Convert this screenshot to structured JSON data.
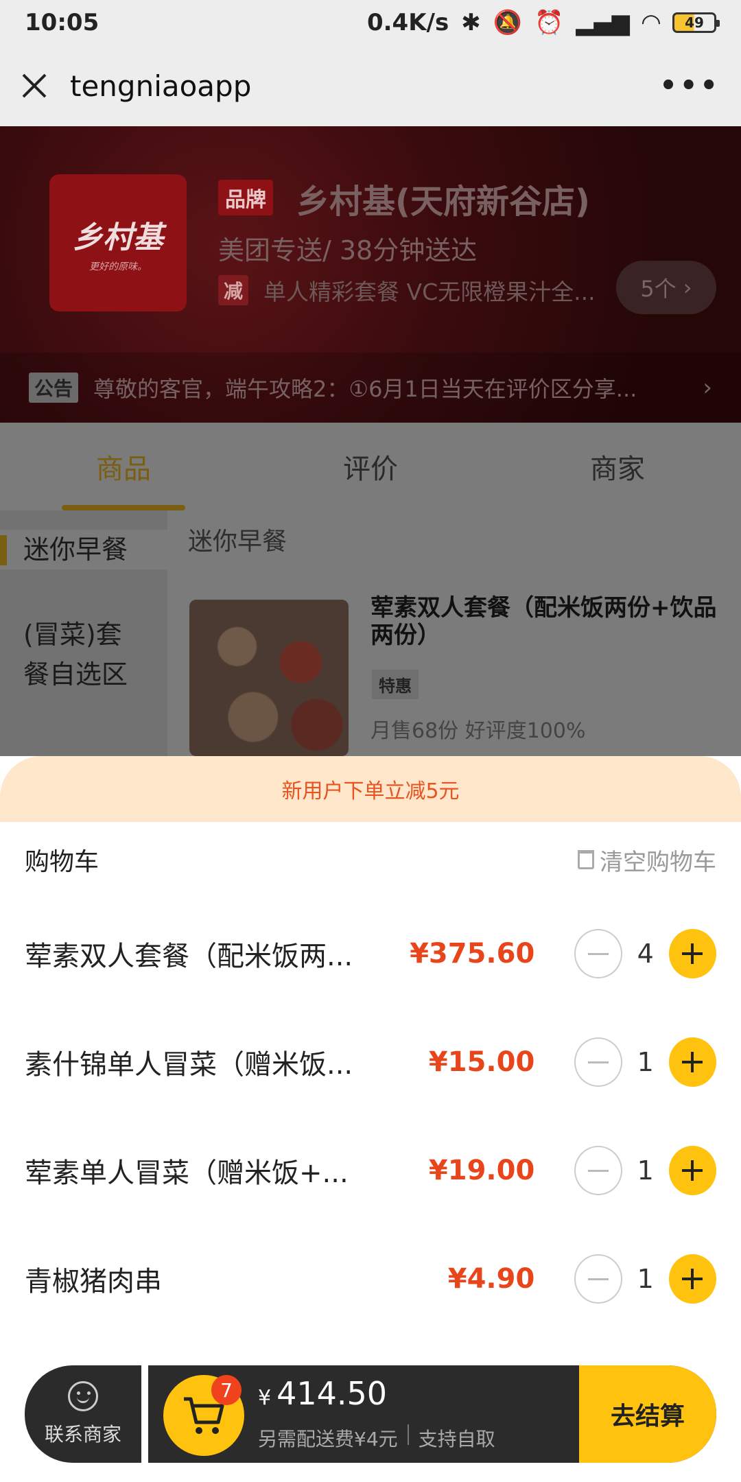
{
  "status_bar": {
    "time": "10:05",
    "speed": "0.4K/s",
    "battery": "49"
  },
  "title_bar": {
    "title": "tengniaoapp"
  },
  "shop": {
    "logo_text": "乡村基",
    "logo_sub": "更好的原味。",
    "brand_tag": "品牌",
    "name": "乡村基(天府新谷店)",
    "delivery": "美团专送/ 38分钟送达",
    "promo_tag": "减",
    "promo_text": "单人精彩套餐 VC无限橙果汁全...",
    "promo_count": "5个",
    "notice_tag": "公告",
    "notice_text": "尊敬的客官，端午攻略2：①6月1日当天在评价区分享..."
  },
  "tabs": [
    "商品",
    "评价",
    "商家"
  ],
  "sidebar": {
    "categories": [
      "迷你早餐",
      "(冒菜)套",
      "餐自选区"
    ]
  },
  "section": {
    "title": "迷你早餐",
    "dish": {
      "name": "荤素双人套餐（配米饭两份+饮品两份）",
      "badge": "特惠",
      "meta": "月售68份   好评度100%"
    }
  },
  "promo_bar": {
    "text": "新用户下单立减5元"
  },
  "cart": {
    "title": "购物车",
    "clear_label": "清空购物车",
    "items": [
      {
        "name": "荤素双人套餐（配米饭两...",
        "price": "¥375.60",
        "qty": "4"
      },
      {
        "name": "素什锦单人冒菜（赠米饭...",
        "price": "¥15.00",
        "qty": "1"
      },
      {
        "name": "荤素单人冒菜（赠米饭+...",
        "price": "¥19.00",
        "qty": "1"
      },
      {
        "name": "青椒猪肉串",
        "price": "¥4.90",
        "qty": "1"
      }
    ]
  },
  "bottom_bar": {
    "contact_label": "联系商家",
    "cart_count": "7",
    "currency": "¥",
    "total": "414.50",
    "delivery_fee": "另需配送费¥4元",
    "pickup": "支持自取",
    "checkout_label": "去结算"
  },
  "colors": {
    "accent": "#ffc20e",
    "price": "#e8451b",
    "promo_bg": "#ffe7cc"
  }
}
